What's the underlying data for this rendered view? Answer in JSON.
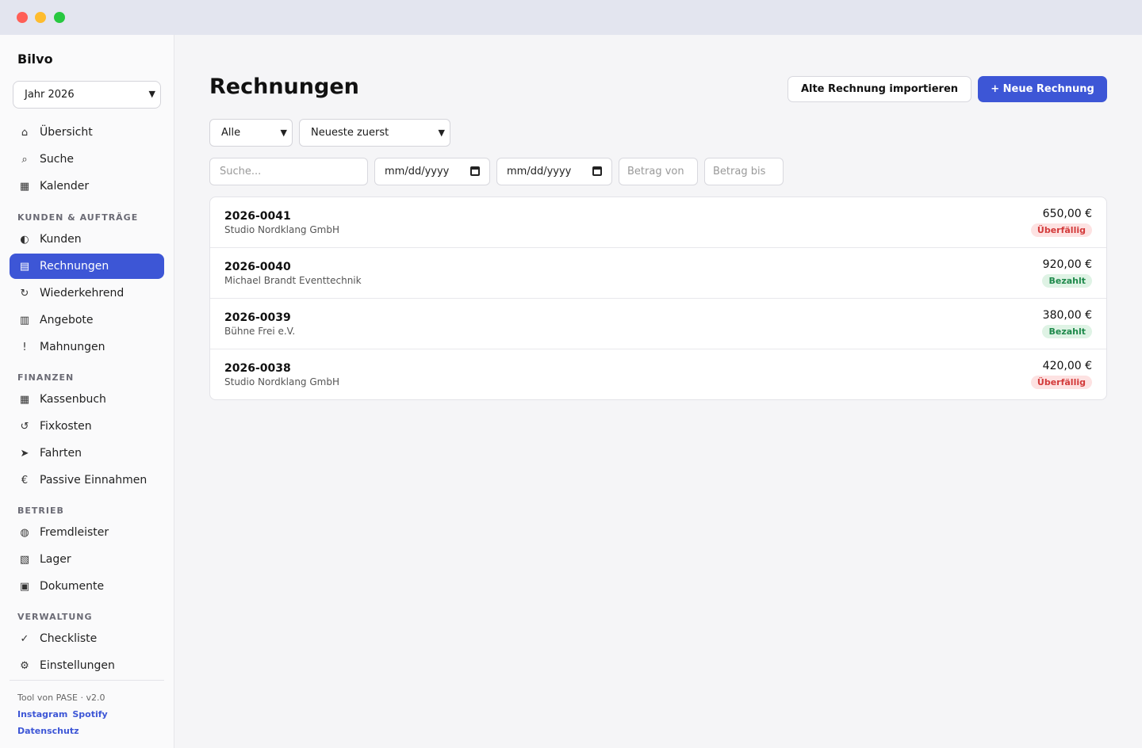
{
  "app": {
    "name": "Bilvo"
  },
  "sidebar": {
    "year_select": "Jahr 2026",
    "items_top": [
      {
        "icon": "home-icon",
        "glyph": "⌂",
        "label": "Übersicht"
      },
      {
        "icon": "search-icon",
        "glyph": "⌕",
        "label": "Suche"
      },
      {
        "icon": "calendar-icon",
        "glyph": "▦",
        "label": "Kalender"
      }
    ],
    "section_kunden": "KUNDEN & AUFTRÄGE",
    "items_kunden": [
      {
        "icon": "customers-icon",
        "glyph": "◐",
        "label": "Kunden"
      },
      {
        "icon": "invoice-icon",
        "glyph": "▤",
        "label": "Rechnungen",
        "active": true
      },
      {
        "icon": "recurring-icon",
        "glyph": "↻",
        "label": "Wiederkehrend"
      },
      {
        "icon": "offers-icon",
        "glyph": "▥",
        "label": "Angebote"
      },
      {
        "icon": "warning-icon",
        "glyph": "!",
        "label": "Mahnungen"
      }
    ],
    "section_finanzen": "FINANZEN",
    "items_finanzen": [
      {
        "icon": "cashbook-icon",
        "glyph": "▦",
        "label": "Kassenbuch"
      },
      {
        "icon": "fixed-costs-icon",
        "glyph": "↺",
        "label": "Fixkosten"
      },
      {
        "icon": "trips-icon",
        "glyph": "➤",
        "label": "Fahrten"
      },
      {
        "icon": "euro-icon",
        "glyph": "€",
        "label": "Passive Einnahmen"
      }
    ],
    "section_betrieb": "BETRIEB",
    "items_betrieb": [
      {
        "icon": "contractors-icon",
        "glyph": "◍",
        "label": "Fremdleister"
      },
      {
        "icon": "storage-icon",
        "glyph": "▧",
        "label": "Lager"
      },
      {
        "icon": "documents-icon",
        "glyph": "▣",
        "label": "Dokumente"
      }
    ],
    "section_verwaltung": "VERWALTUNG",
    "items_verwaltung": [
      {
        "icon": "checklist-icon",
        "glyph": "✓",
        "label": "Checkliste"
      },
      {
        "icon": "gear-icon",
        "glyph": "⚙",
        "label": "Einstellungen"
      }
    ],
    "footer": {
      "text": "Tool von PASE · v2.0",
      "links": [
        "Instagram",
        "Spotify",
        "Datenschutz"
      ]
    }
  },
  "main": {
    "title": "Rechnungen",
    "import_button": "Alte Rechnung importieren",
    "new_button": "+ Neue Rechnung",
    "filter_status": "Alle",
    "filter_sort": "Neueste zuerst",
    "search_placeholder": "Suche...",
    "date_from": "mm/dd/yyyy",
    "date_to": "mm/dd/yyyy",
    "amount_from_placeholder": "Betrag von",
    "amount_to_placeholder": "Betrag bis"
  },
  "invoices": [
    {
      "number": "2026-0041",
      "client": "Studio Nordklang GmbH",
      "amount": "650,00 €",
      "status": "Überfällig",
      "status_type": "overdue"
    },
    {
      "number": "2026-0040",
      "client": "Michael Brandt Eventtechnik",
      "amount": "920,00 €",
      "status": "Bezahlt",
      "status_type": "paid"
    },
    {
      "number": "2026-0039",
      "client": "Bühne Frei e.V.",
      "amount": "380,00 €",
      "status": "Bezahlt",
      "status_type": "paid"
    },
    {
      "number": "2026-0038",
      "client": "Studio Nordklang GmbH",
      "amount": "420,00 €",
      "status": "Überfällig",
      "status_type": "overdue"
    }
  ],
  "colors": {
    "accent": "#3d56d6",
    "overdue": "#d33a3a",
    "paid": "#1f8a4c"
  }
}
